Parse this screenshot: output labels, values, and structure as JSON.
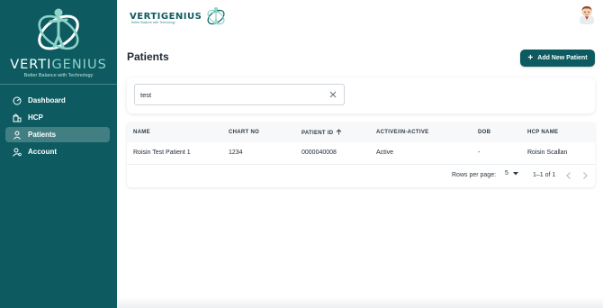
{
  "brand": {
    "name_part1": "VERTI",
    "name_part2": "GENIUS",
    "tagline": "Better Balance with Technology",
    "primary_color": "#0d5b61",
    "accent_color": "#8fd3c8"
  },
  "sidebar": {
    "items": [
      {
        "label": "Dashboard",
        "icon": "dashboard-icon",
        "active": false
      },
      {
        "label": "HCP",
        "icon": "building-icon",
        "active": false
      },
      {
        "label": "Patients",
        "icon": "person-icon",
        "active": true
      },
      {
        "label": "Account",
        "icon": "account-settings-icon",
        "active": false
      }
    ]
  },
  "topbar": {
    "logo_text": "VERTIGENIUS",
    "logo_sub": "Better Balance with Technology"
  },
  "main": {
    "title": "Patients",
    "add_button_label": "Add New Patient",
    "search": {
      "value": "test",
      "placeholder": ""
    },
    "table": {
      "columns": [
        "NAME",
        "CHART NO",
        "PATIENT ID",
        "ACTIVE/IN-ACTIVE",
        "DOB",
        "HCP NAME"
      ],
      "sorted_column": "PATIENT ID",
      "sort_direction": "ascending",
      "rows": [
        [
          "Roisin Test Patient 1",
          "1234",
          "0000040008",
          "Active",
          "-",
          "Roisin Scallan"
        ]
      ]
    },
    "pagination": {
      "rows_per_page_label": "Rows per page:",
      "rows_per_page": "5",
      "range": "1–1 of 1"
    }
  }
}
